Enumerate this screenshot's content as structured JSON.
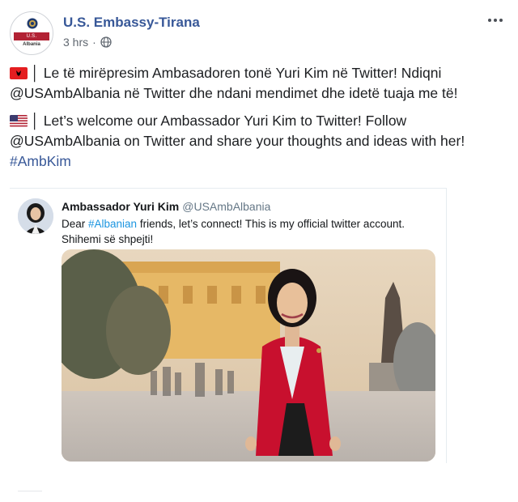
{
  "post": {
    "page_name": "U.S. Embassy-Tirana",
    "timestamp": "3 hrs",
    "separator": "·",
    "privacy_icon": "globe-icon",
    "avatar": {
      "seal_text": "U.S. EMBASSY",
      "sub_text": "Albania"
    },
    "paragraphs": [
      {
        "flag": "albania-flag-icon",
        "text": "│ Le të mirëpresim Ambasadoren tonë Yuri Kim në Twitter! Ndiqni @USAmbAlbania në Twitter dhe ndani mendimet dhe idetë tuaja me të!"
      },
      {
        "flag": "usa-flag-icon",
        "text": "│ Let’s welcome our Ambassador Yuri Kim to Twitter! Follow @USAmbAlbania on Twitter and share your thoughts and ideas with her!"
      }
    ],
    "hashtag": "#AmbKim"
  },
  "tweet": {
    "author_name": "Ambassador Yuri Kim",
    "author_handle": "@USAmbAlbania",
    "text_before": "Dear ",
    "text_link": "#Albanian",
    "text_after": " friends, let’s connect! This is my official twitter account. Shihemi së shpejti!"
  },
  "colors": {
    "link_blue": "#385898",
    "twitter_blue": "#1b95e0",
    "jacket_red": "#c8102e"
  }
}
